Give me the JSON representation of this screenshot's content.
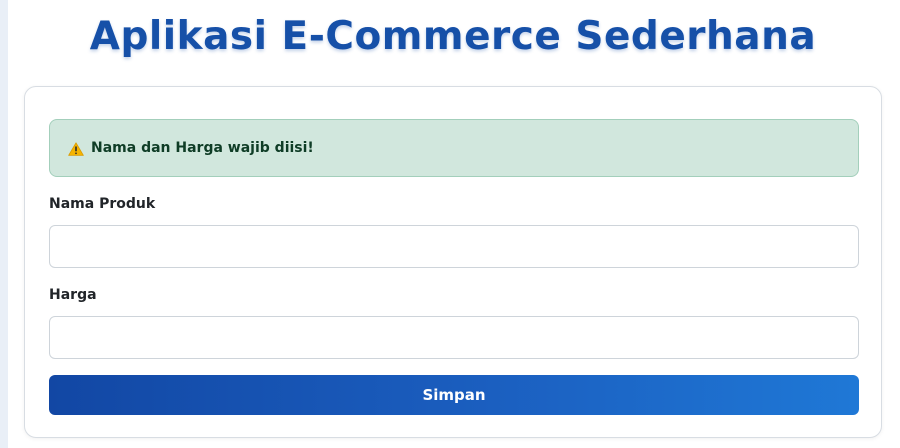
{
  "header": {
    "title": "Aplikasi E-Commerce Sederhana"
  },
  "alert": {
    "icon": "warning-icon",
    "message": "Nama dan Harga wajib diisi!",
    "background_color": "#d1e7dd",
    "text_color": "#0f3d26"
  },
  "form": {
    "fields": [
      {
        "label": "Nama Produk",
        "value": "",
        "placeholder": ""
      },
      {
        "label": "Harga",
        "value": "",
        "placeholder": ""
      }
    ],
    "submit_label": "Simpan"
  },
  "colors": {
    "title": "#1650a8",
    "button_gradient_start": "#1247a4",
    "button_gradient_end": "#1f78d6"
  }
}
